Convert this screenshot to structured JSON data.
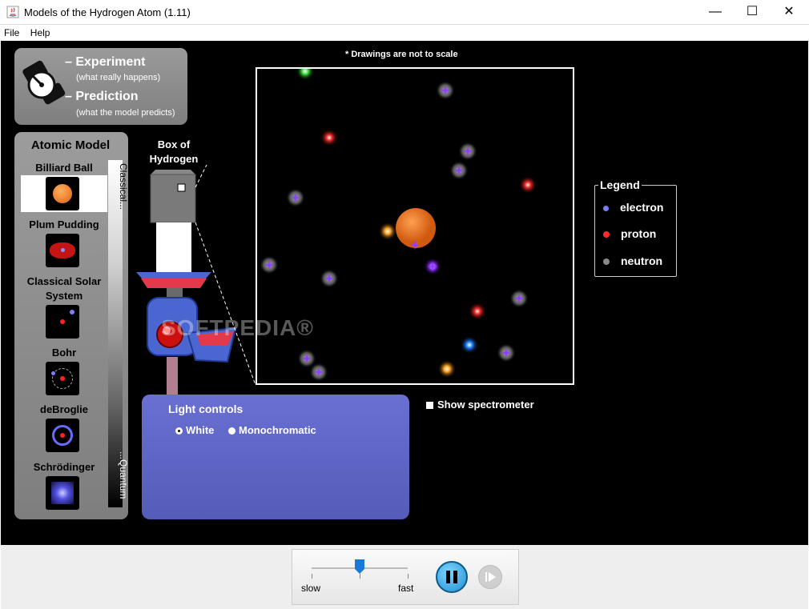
{
  "window": {
    "title": "Models of the Hydrogen Atom (1.11)",
    "minimize": "—",
    "maximize": "☐",
    "close": "✕"
  },
  "menu": {
    "file": "File",
    "help": "Help"
  },
  "mode": {
    "experiment": "Experiment",
    "experiment_sub": "(what really happens)",
    "prediction": "Prediction",
    "prediction_sub": "(what the model predicts)"
  },
  "atomic_model": {
    "title": "Atomic Model",
    "selected": "Billiard Ball",
    "items": [
      {
        "label": "Billiard Ball"
      },
      {
        "label": "Plum Pudding"
      },
      {
        "label": "Classical Solar System"
      },
      {
        "label": "Bohr"
      },
      {
        "label": "deBroglie"
      },
      {
        "label": "Schrödinger"
      }
    ],
    "scale_top": "Classical...",
    "scale_bottom": "...Quantum"
  },
  "box": {
    "label": "Box of Hydrogen"
  },
  "view": {
    "note": "* Drawings are not to scale"
  },
  "legend": {
    "title": "Legend",
    "items": [
      {
        "label": "electron",
        "color": "#7b7bff"
      },
      {
        "label": "proton",
        "color": "#ff2a2a"
      },
      {
        "label": "neutron",
        "color": "#8a8a8a"
      }
    ]
  },
  "light": {
    "title": "Light controls",
    "options": [
      "White",
      "Monochromatic"
    ],
    "selected": "White"
  },
  "spectrometer": {
    "label": "Show spectrometer",
    "checked": false
  },
  "watermark": "SOFTPEDIA®",
  "clock": {
    "slow": "slow",
    "fast": "fast",
    "speed_fraction": 0.5,
    "state": "running"
  }
}
